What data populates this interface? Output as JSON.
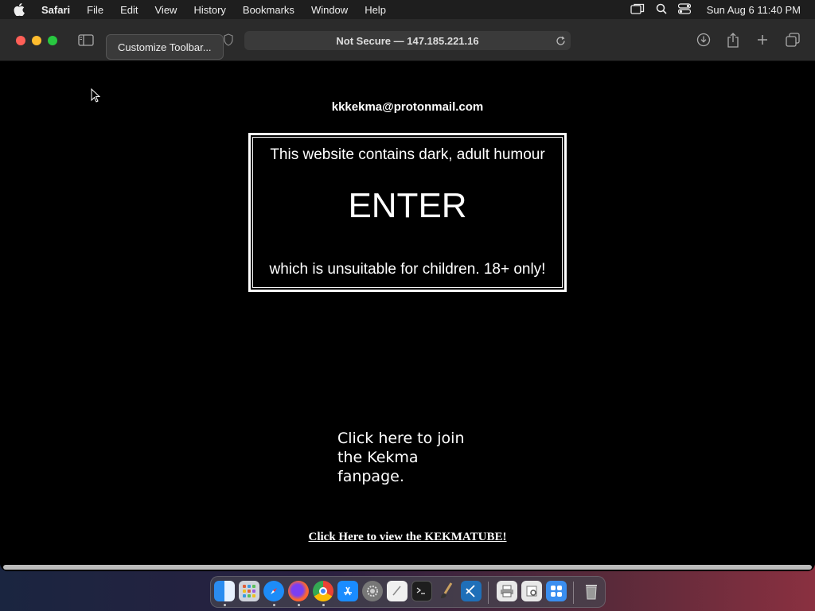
{
  "menubar": {
    "app": "Safari",
    "items": [
      "File",
      "Edit",
      "View",
      "History",
      "Bookmarks",
      "Window",
      "Help"
    ],
    "clock": "Sun Aug 6  11:40 PM"
  },
  "toolbar": {
    "tooltip": "Customize Toolbar...",
    "address": "Not Secure — 147.185.221.16"
  },
  "page": {
    "email": "kkkekma@protonmail.com",
    "warning_top": "This website contains dark, adult humour",
    "enter": "ENTER",
    "warning_bottom": "which is unsuitable for children. 18+ only!",
    "fanpage_link": "Click here to join the Kekma fanpage.",
    "kekmatube_link": "Click Here to view the KEKMATUBE!"
  },
  "dock": {
    "apps": [
      "finder",
      "launchpad",
      "safari",
      "firefox",
      "chrome",
      "app-store",
      "system-settings",
      "textedit",
      "terminal",
      "paintbrush",
      "vscode",
      "printer",
      "preview",
      "utilities",
      "trash"
    ]
  }
}
